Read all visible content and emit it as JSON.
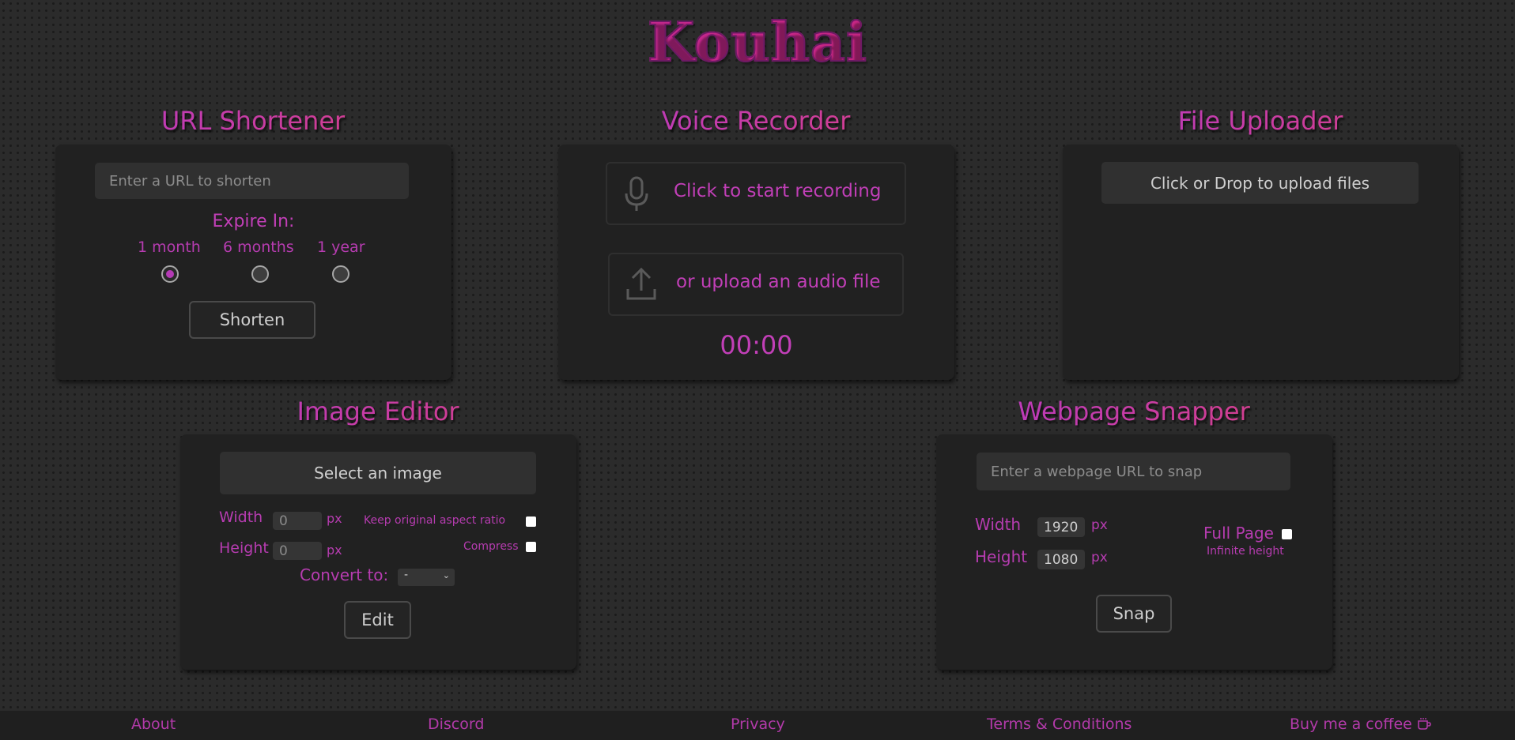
{
  "logo": "Kouhai",
  "url_shortener": {
    "title": "URL Shortener",
    "placeholder": "Enter a URL to shorten",
    "expire_label": "Expire In:",
    "options": [
      "1 month",
      "6 months",
      "1 year"
    ],
    "selected": "1 month",
    "button": "Shorten"
  },
  "voice_recorder": {
    "title": "Voice Recorder",
    "record_label": "Click to start recording",
    "upload_label": "or upload an audio file",
    "timer": "00:00"
  },
  "file_uploader": {
    "title": "File Uploader",
    "button": "Click or Drop to upload files"
  },
  "image_editor": {
    "title": "Image Editor",
    "select_button": "Select an image",
    "width_label": "Width",
    "width_value": "0",
    "height_label": "Height",
    "height_value": "0",
    "unit": "px",
    "keep_ratio_label": "Keep original aspect ratio",
    "compress_label": "Compress",
    "convert_label": "Convert to:",
    "convert_value": "-",
    "button": "Edit"
  },
  "webpage_snapper": {
    "title": "Webpage Snapper",
    "placeholder": "Enter a webpage URL to snap",
    "width_label": "Width",
    "width_value": "1920",
    "height_label": "Height",
    "height_value": "1080",
    "unit": "px",
    "full_page_label": "Full Page",
    "full_page_hint": "Infinite height",
    "button": "Snap"
  },
  "footer": {
    "links": [
      "About",
      "Discord",
      "Privacy",
      "Terms & Conditions",
      "Buy me a coffee"
    ]
  },
  "colors": {
    "accent_pink": "#c13fb7",
    "accent_red": "#d9246a",
    "card_bg": "#212121",
    "page_bg": "#2b2b2b"
  }
}
